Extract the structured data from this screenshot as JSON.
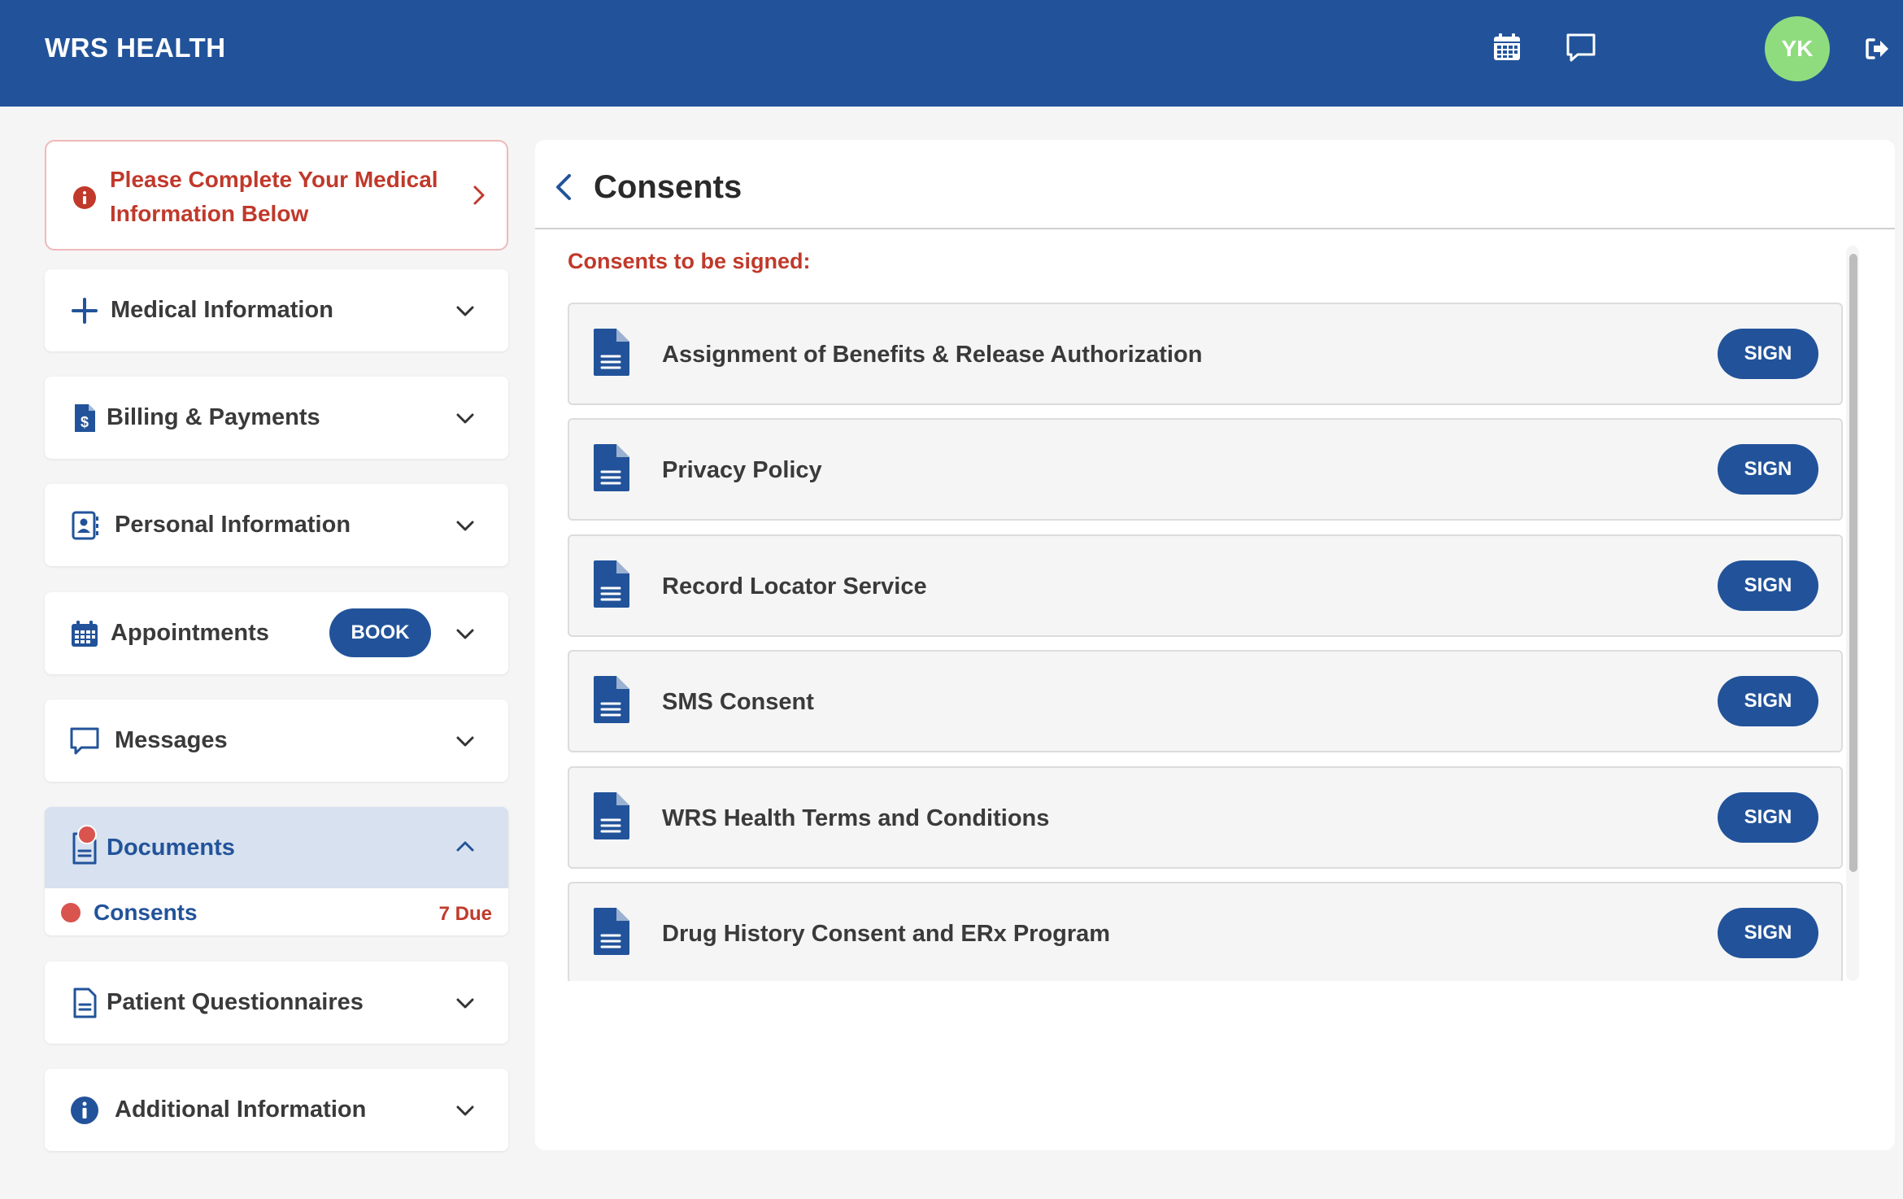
{
  "app": {
    "brand": "WRS HEALTH",
    "user_initials": "YK"
  },
  "colors": {
    "primary": "#22539a",
    "alert": "#c0392b",
    "avatar": "#8fdc7e",
    "badge": "#d9534f"
  },
  "header": {
    "icons": [
      "calendar-icon",
      "chat-icon",
      "logout-icon"
    ]
  },
  "alert": {
    "text": "Please Complete Your Medical Information Below"
  },
  "sidebar": {
    "items": [
      {
        "label": "Medical Information",
        "icon": "plus-icon"
      },
      {
        "label": "Billing & Payments",
        "icon": "billing-document-icon"
      },
      {
        "label": "Personal Information",
        "icon": "contact-card-icon"
      },
      {
        "label": "Appointments",
        "icon": "calendar-icon",
        "action": "BOOK"
      },
      {
        "label": "Messages",
        "icon": "chat-icon"
      },
      {
        "label": "Documents",
        "icon": "document-icon",
        "expanded": true,
        "children": [
          {
            "label": "Consents",
            "due": "7 Due"
          }
        ]
      },
      {
        "label": "Patient Questionnaires",
        "icon": "questionnaire-icon"
      },
      {
        "label": "Additional Information",
        "icon": "info-icon"
      }
    ]
  },
  "main": {
    "title": "Consents",
    "section_label": "Consents to be signed:",
    "sign_label": "SIGN",
    "consents": [
      {
        "name": "Assignment of Benefits & Release Authorization"
      },
      {
        "name": "Privacy Policy"
      },
      {
        "name": "Record Locator Service"
      },
      {
        "name": "SMS Consent"
      },
      {
        "name": "WRS Health Terms and Conditions"
      },
      {
        "name": "Drug History Consent and ERx Program"
      }
    ]
  }
}
